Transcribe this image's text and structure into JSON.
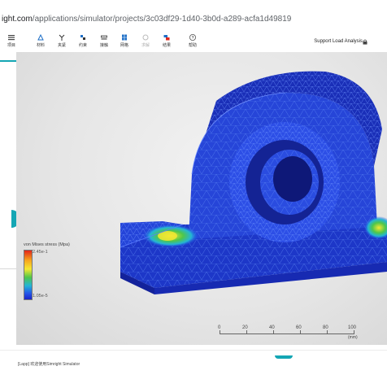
{
  "browser": {
    "url_host": "ight.com",
    "url_path": "/applications/simulator/projects/3c03df29-1d40-3b0d-a289-acfa1d49819"
  },
  "toolbar": {
    "items": [
      {
        "label": "项目",
        "icon": "menu-icon",
        "disabled": false
      },
      {
        "label": "材料",
        "icon": "material-icon",
        "disabled": false
      },
      {
        "label": "夹紧",
        "icon": "clamp-icon",
        "disabled": false
      },
      {
        "label": "约束",
        "icon": "constraint-icon",
        "disabled": false
      },
      {
        "label": "接触",
        "icon": "contact-icon",
        "disabled": false
      },
      {
        "label": "网格",
        "icon": "mesh-icon",
        "disabled": false
      },
      {
        "label": "求解",
        "icon": "solve-icon",
        "disabled": true
      },
      {
        "label": "结果",
        "icon": "results-icon",
        "disabled": false
      },
      {
        "label": "帮助",
        "icon": "help-icon",
        "disabled": false
      }
    ],
    "project_title": "Support Load Analysis"
  },
  "legend": {
    "title": "von Mises stress (Mpa)",
    "max": "2.45e-1",
    "min": "1.05e-5",
    "colors": [
      "#e1251b",
      "#f7a51d",
      "#f5e832",
      "#4fc64a",
      "#24b5d6",
      "#2454e8",
      "#1a24c8"
    ]
  },
  "scale": {
    "labels": [
      "0",
      "20",
      "40",
      "60",
      "80",
      "100"
    ],
    "unit": "(mm)"
  },
  "footer": {
    "text": "[Lapp] 欢迎使用Simright Simulator"
  },
  "colors": {
    "accent": "#14a6b4",
    "mesh_blue": "#2340d8"
  }
}
